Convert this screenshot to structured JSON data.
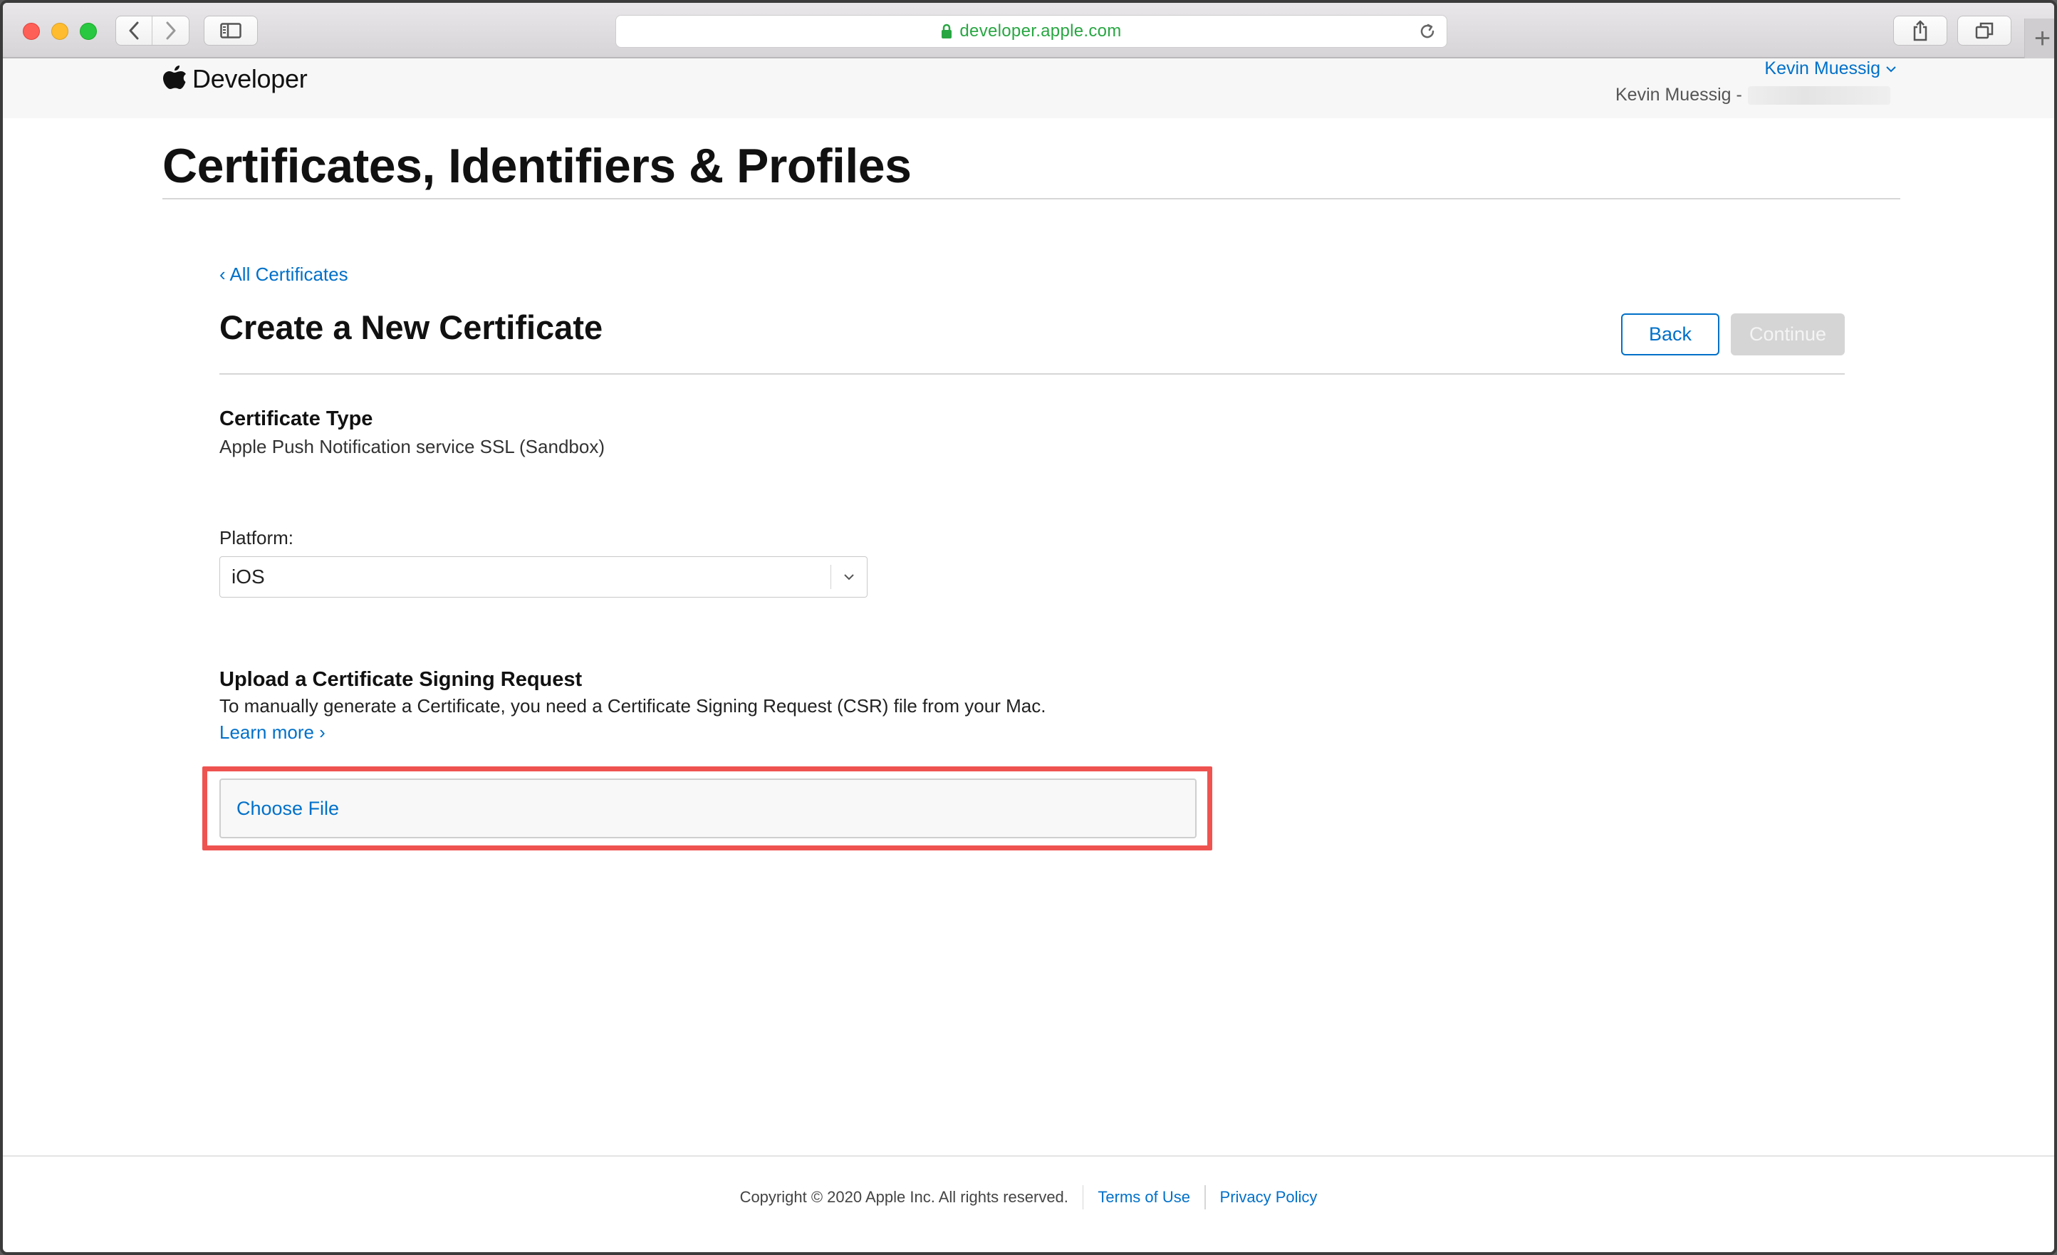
{
  "browser": {
    "url": "developer.apple.com",
    "icons": {
      "back": "chevron-left-icon",
      "forward": "chevron-right-icon",
      "sidebar": "sidebar-icon",
      "lock": "lock-icon",
      "reload": "reload-icon",
      "share": "share-icon",
      "tabs": "tabs-overview-icon",
      "new_tab": "plus-icon"
    },
    "new_tab_glyph": "+"
  },
  "header": {
    "brand": "Developer",
    "logo_icon": "apple-logo-icon",
    "account_name": "Kevin Muessig",
    "team_name": "Kevin Muessig -"
  },
  "page": {
    "title": "Certificates, Identifiers & Profiles"
  },
  "form": {
    "back_link": "‹ All Certificates",
    "title": "Create a New Certificate",
    "back_button": "Back",
    "continue_button": "Continue",
    "certificate_type_label": "Certificate Type",
    "certificate_type_value": "Apple Push Notification service SSL (Sandbox)",
    "platform_label": "Platform:",
    "platform_value": "iOS",
    "csr_title": "Upload a Certificate Signing Request",
    "csr_description": "To manually generate a Certificate, you need a Certificate Signing Request (CSR) file from your Mac.",
    "learn_more": "Learn more ›",
    "choose_file": "Choose File"
  },
  "footer": {
    "copyright": "Copyright © 2020 Apple Inc. All rights reserved.",
    "terms": "Terms of Use",
    "privacy": "Privacy Policy"
  },
  "colors": {
    "link": "#0070c9",
    "highlight": "#ef5350",
    "url": "#28a642",
    "disabled_button": "#d5d5d5"
  }
}
